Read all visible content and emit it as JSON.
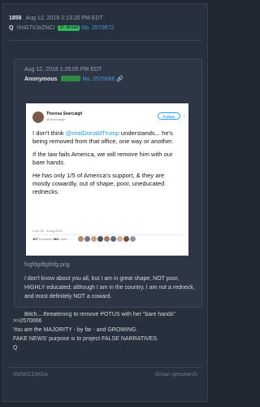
{
  "post": {
    "number": "1858",
    "date": "Aug 12, 2018 2:13:20 PM EDT",
    "name": "Q",
    "tripcode": "!!mG7VJxZNCI",
    "id_badge": "ID: 4fc2a8",
    "post_no": "No. 2570672"
  },
  "quoted": {
    "date": "Aug 12, 2018 1:26:05 PM EDT",
    "name": "Anonymous",
    "post_no": "No. 2570066",
    "filename": "fxgfdgdfgdsfg.png",
    "body1": "I don't know about you all, but I am in great shape, NOT poor, HIGHLY educated; although I am in the country, I am not a redneck, and most definitely NOT a coward.",
    "body2": "Bitch....threatening to remove POTUS with her \"bare hands\""
  },
  "tweet": {
    "name": "Theresa Searcaigh",
    "handle": "@Tsearcaigh",
    "follow": "Follow",
    "p1_pre": "I don't think ",
    "p1_mention": "@realDonaldTrump",
    "p1_post": " understands... he's being removed from that office, one way or another.",
    "p2": "If the law fails America, we will remove him with our bare hands.",
    "p3": "He has only 1/5 of America's support, & they are mostly cowardly, out of shape, poor, uneducated rednecks.",
    "time": "5:16 PM - 8 Aug 2018",
    "retweets": "107",
    "retweets_label": "Retweets",
    "likes": "862",
    "likes_label": "Likes"
  },
  "reply": {
    "ref": ">>2570066",
    "line1": "You are the MAJORITY - by far - and GROWING.",
    "line2": "FAKE NEWS' purpose is to project FALSE NARRATIVES.",
    "sign": "Q"
  },
  "footer": {
    "tag": "#WWG1WGA",
    "source": "8chan qresearch"
  }
}
